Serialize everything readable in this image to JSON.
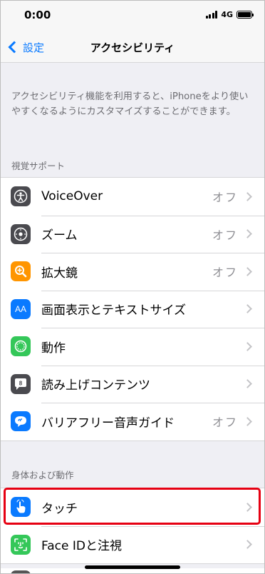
{
  "status": {
    "time": "0:00",
    "network": "4G"
  },
  "nav": {
    "back_label": "設定",
    "title": "アクセシビリティ"
  },
  "intro": "アクセシビリティ機能を利用すると、iPhoneをより使いやすくなるようにカスタマイズすることができます。",
  "sections": {
    "vision": {
      "header": "視覚サポート",
      "items": [
        {
          "label": "VoiceOver",
          "value": "オフ",
          "icon": "voiceover-icon",
          "color": "#4a4a4f"
        },
        {
          "label": "ズーム",
          "value": "オフ",
          "icon": "zoom-icon",
          "color": "#4a4a4f"
        },
        {
          "label": "拡大鏡",
          "value": "オフ",
          "icon": "magnifier-icon",
          "color": "#ff9500"
        },
        {
          "label": "画面表示とテキストサイズ",
          "value": "",
          "icon": "display-text-size-icon",
          "color": "#0a7aff"
        },
        {
          "label": "動作",
          "value": "",
          "icon": "motion-icon",
          "color": "#34c759"
        },
        {
          "label": "読み上げコンテンツ",
          "value": "",
          "icon": "spoken-content-icon",
          "color": "#4a4a4f"
        },
        {
          "label": "バリアフリー音声ガイド",
          "value": "オフ",
          "icon": "audio-descriptions-icon",
          "color": "#0a7aff"
        }
      ]
    },
    "physical": {
      "header": "身体および動作",
      "items": [
        {
          "label": "タッチ",
          "value": "",
          "icon": "touch-icon",
          "color": "#0a7aff"
        },
        {
          "label": "Face IDと注視",
          "value": "",
          "icon": "face-id-icon",
          "color": "#34c759"
        }
      ]
    }
  },
  "icon_glyphs": {
    "aa": "AA",
    "spoken": "Ꞓ0"
  }
}
